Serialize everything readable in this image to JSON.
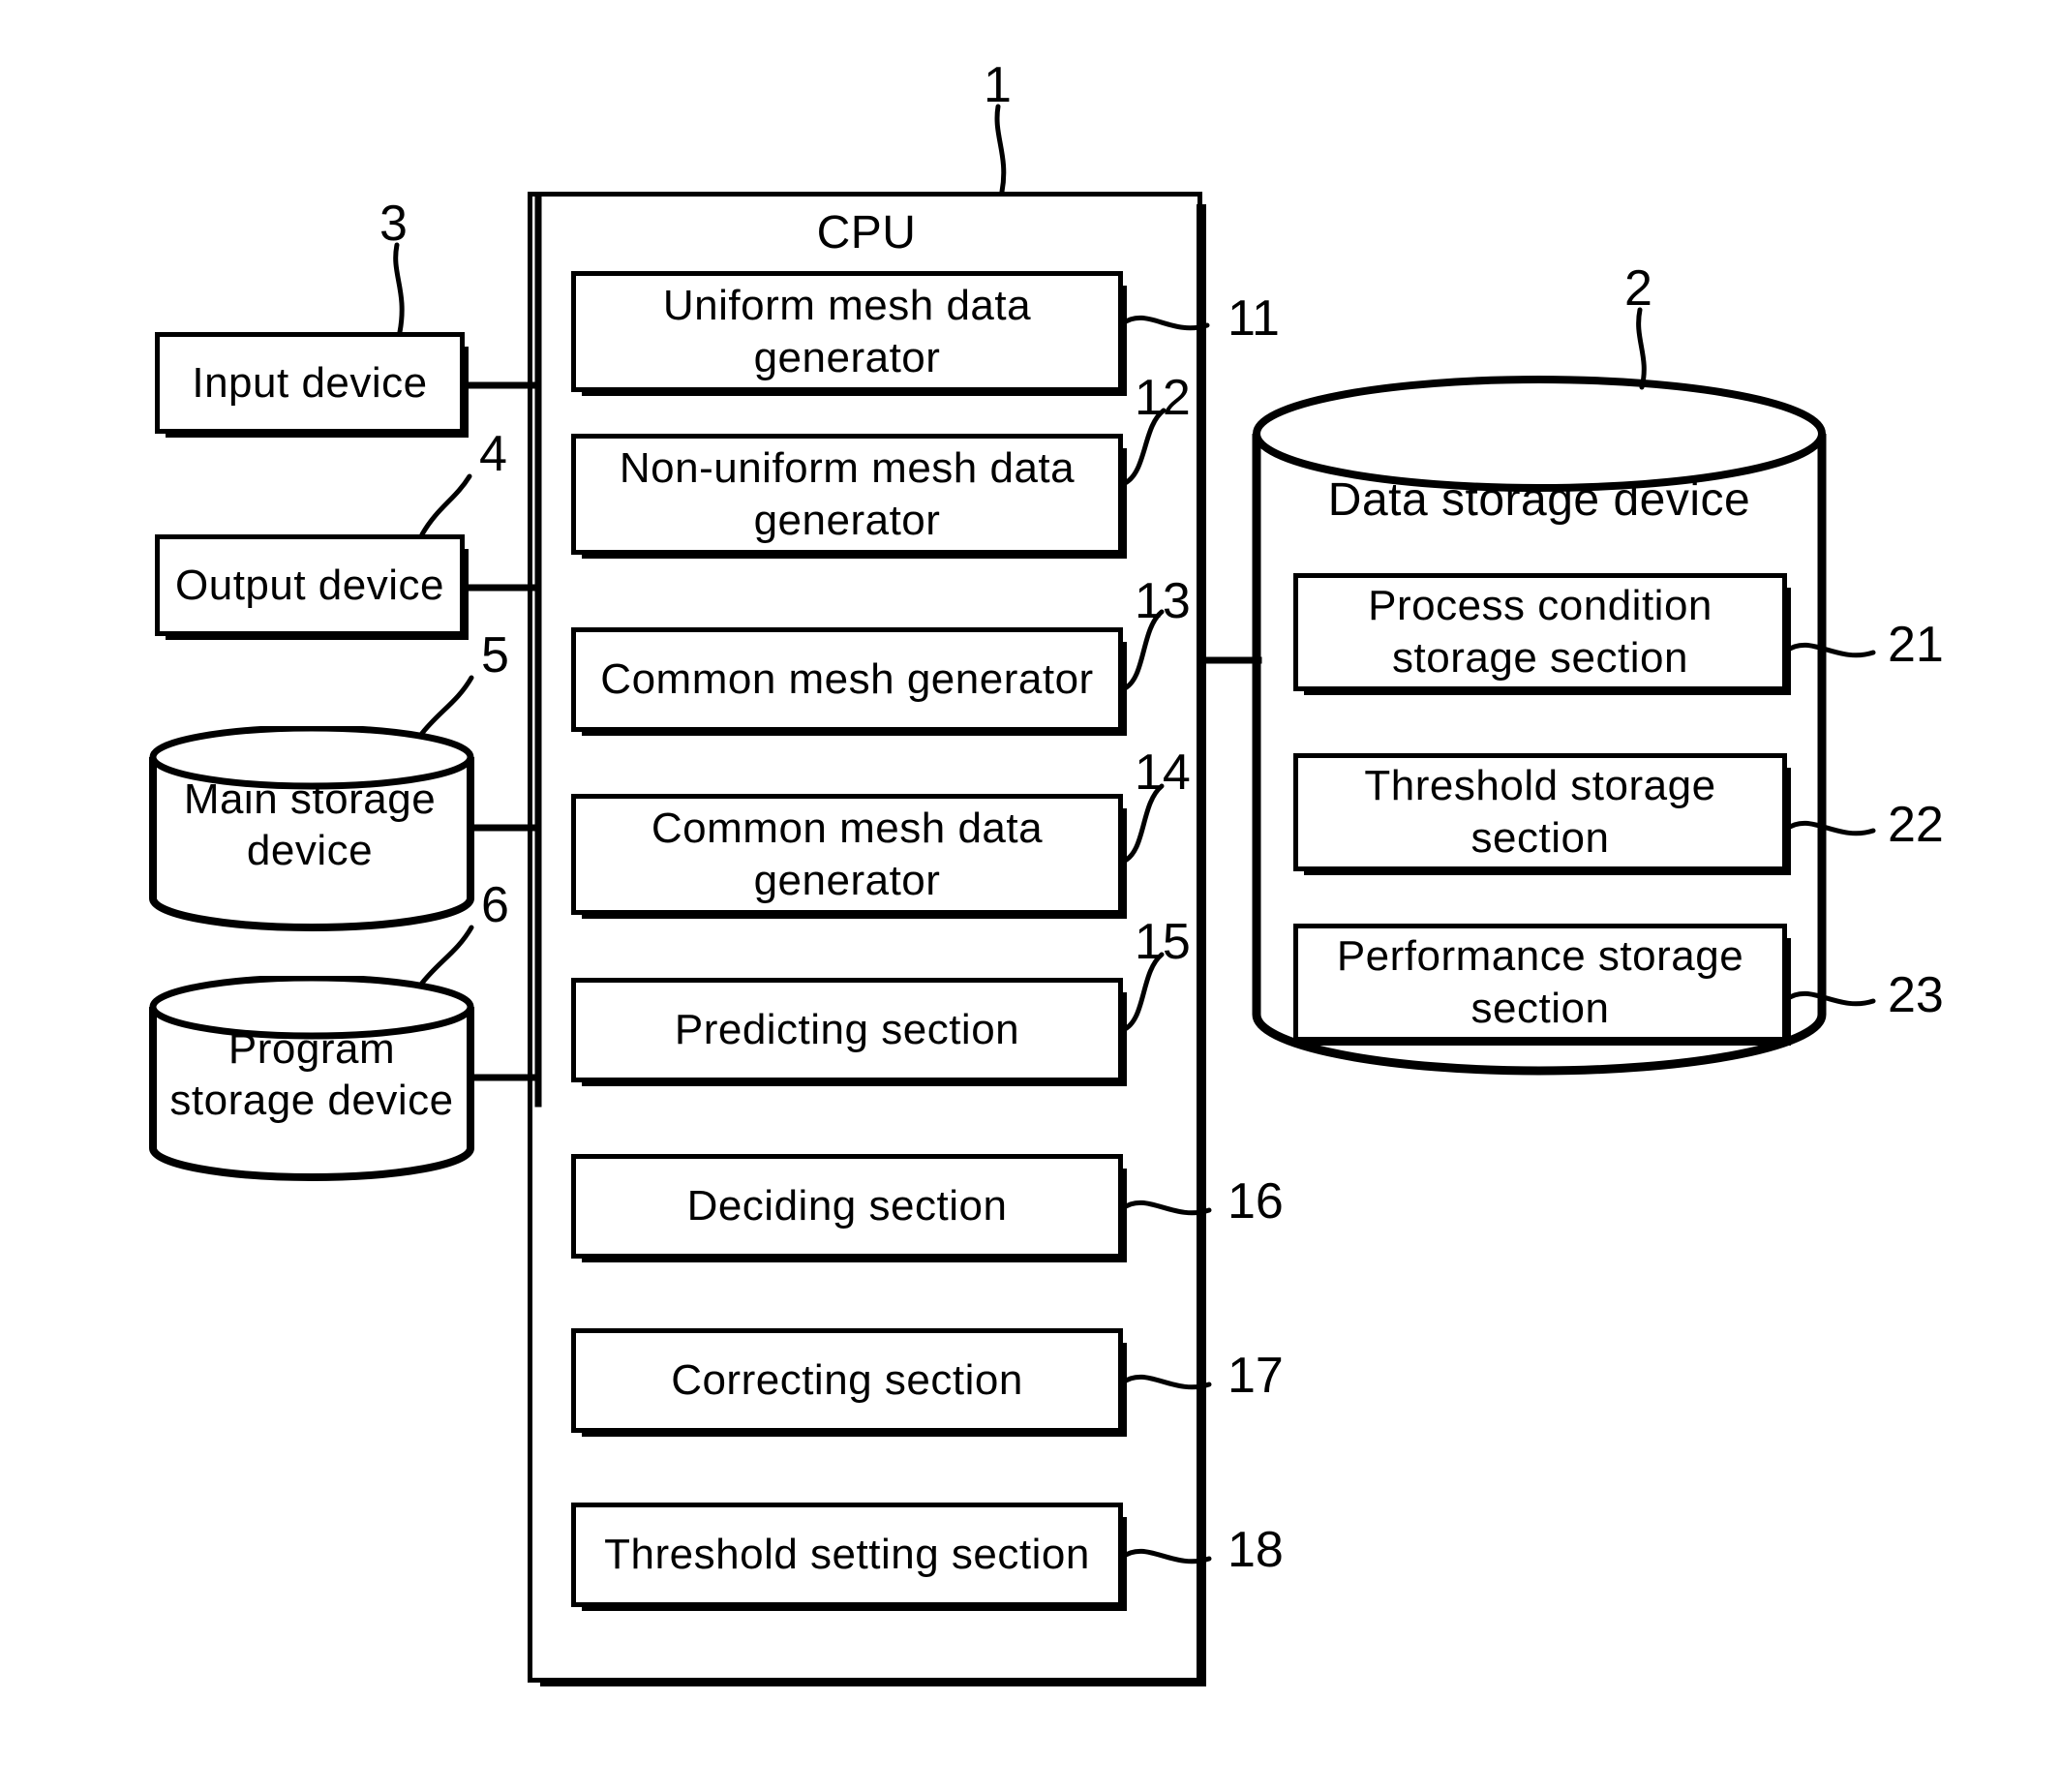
{
  "figure": {
    "title": "Computer system block diagram",
    "cpu": {
      "title": "CPU",
      "ref": "1",
      "modules": [
        {
          "label": "Uniform mesh data\ngenerator",
          "ref": "11"
        },
        {
          "label": "Non-uniform mesh data\ngenerator",
          "ref": "12"
        },
        {
          "label": "Common mesh generator",
          "ref": "13"
        },
        {
          "label": "Common mesh data\ngenerator",
          "ref": "14"
        },
        {
          "label": "Predicting section",
          "ref": "15"
        },
        {
          "label": "Deciding section",
          "ref": "16"
        },
        {
          "label": "Correcting section",
          "ref": "17"
        },
        {
          "label": "Threshold setting section",
          "ref": "18"
        }
      ]
    },
    "peripherals": [
      {
        "label": "Input device",
        "ref": "3",
        "shape": "rect"
      },
      {
        "label": "Output device",
        "ref": "4",
        "shape": "rect"
      },
      {
        "label": "Main storage\ndevice",
        "ref": "5",
        "shape": "cylinder"
      },
      {
        "label": "Program\nstorage device",
        "ref": "6",
        "shape": "cylinder"
      }
    ],
    "storage": {
      "label": "Data storage device",
      "ref": "2",
      "shape": "cylinder",
      "sections": [
        {
          "label": "Process condition\nstorage section",
          "ref": "21"
        },
        {
          "label": "Threshold storage\nsection",
          "ref": "22"
        },
        {
          "label": "Performance storage\nsection",
          "ref": "23"
        }
      ]
    },
    "colors": {
      "ink": "#000000",
      "paper": "#ffffff"
    }
  }
}
